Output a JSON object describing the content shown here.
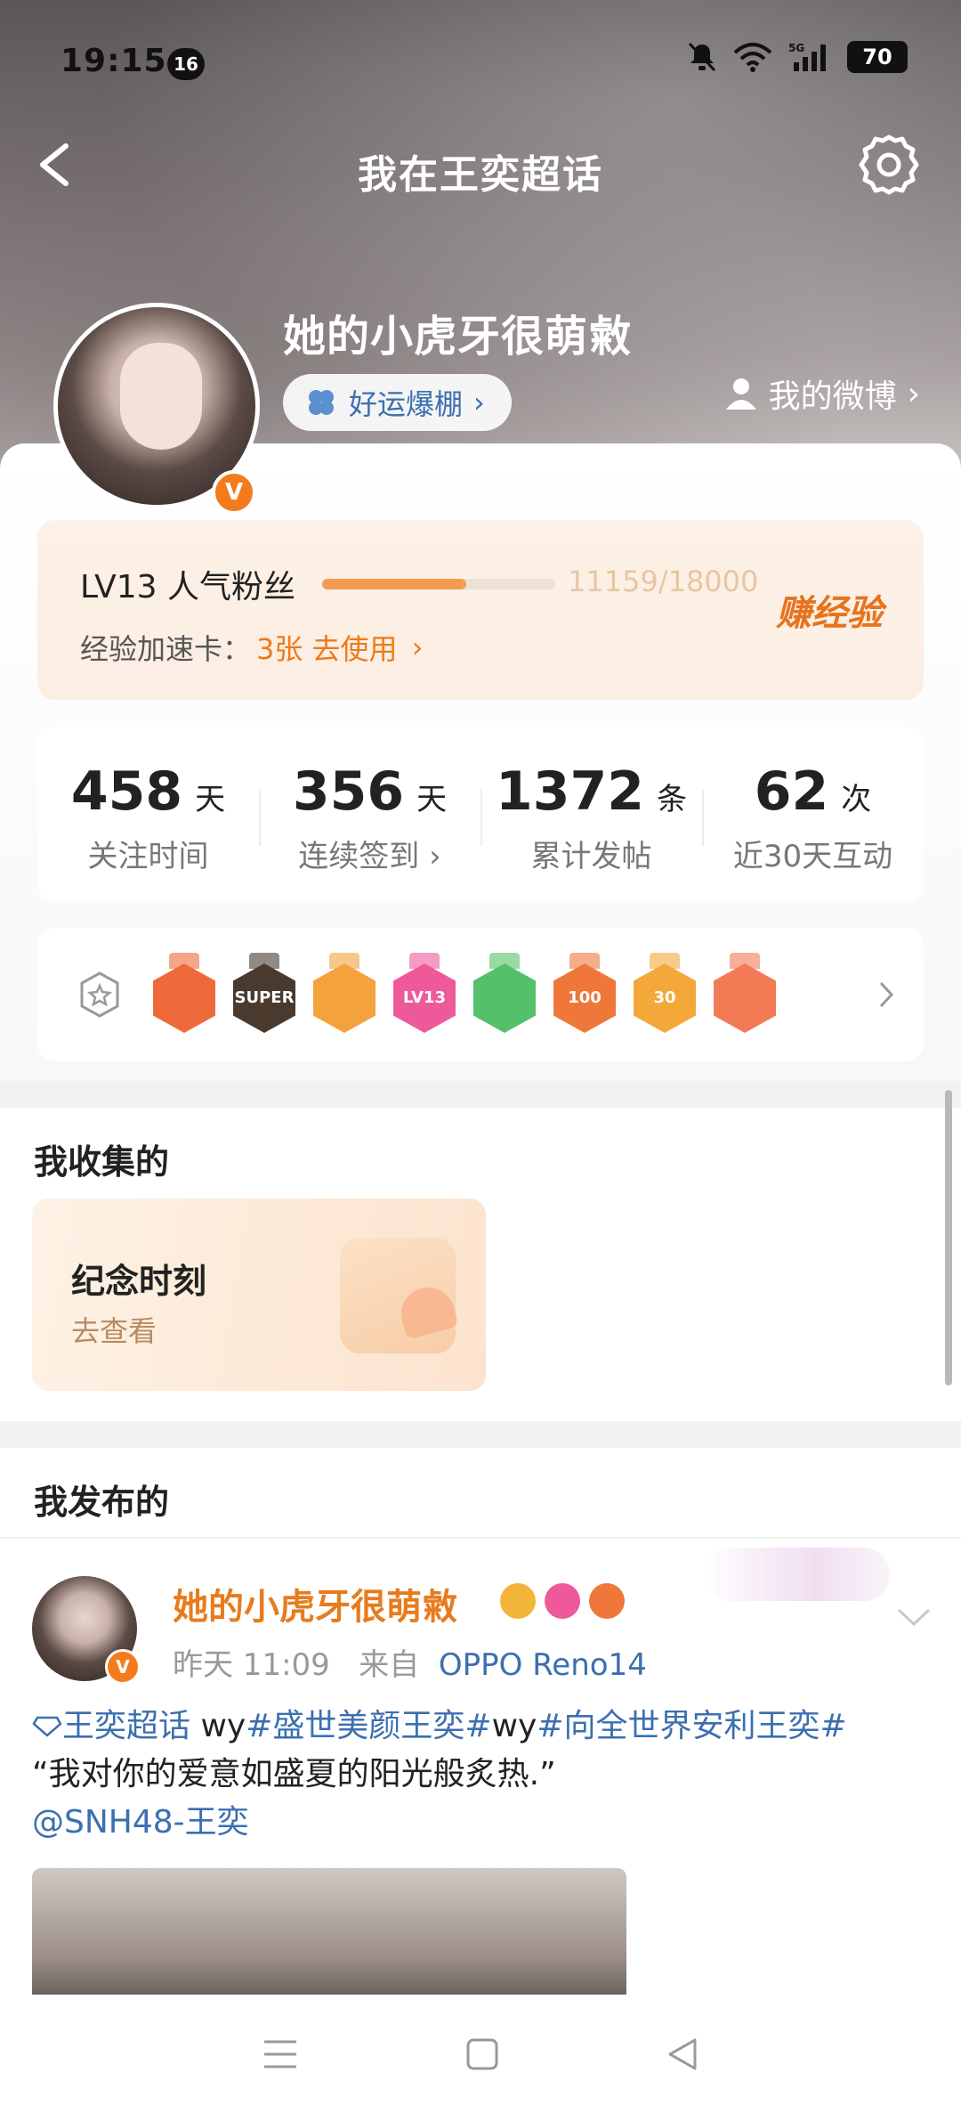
{
  "status_bar": {
    "time": "19:15",
    "notif_count": "16",
    "battery": "70"
  },
  "header": {
    "title": "我在王奕超话"
  },
  "profile": {
    "username": "她的小虎牙很萌敹",
    "luck_tag": "好运爆棚",
    "my_weibo": "我的微博"
  },
  "level": {
    "label": "LV13 人气粉丝",
    "progress_text": "11159/18000",
    "progress_fraction": 0.62,
    "exp_card_label": "经验加速卡：",
    "exp_card_value": "3张 去使用",
    "earn_exp": "赚经验"
  },
  "stats": [
    {
      "value": "458",
      "unit": "天",
      "label": "关注时间"
    },
    {
      "value": "356",
      "unit": "天",
      "label": "连续签到 ›"
    },
    {
      "value": "1372",
      "unit": "条",
      "label": "累计发帖"
    },
    {
      "value": "62",
      "unit": "次",
      "label": "近30天互动"
    }
  ],
  "badges": {
    "items": [
      {
        "name": "fox-medal",
        "text": "",
        "color": "#ef6a3a"
      },
      {
        "name": "super-medal",
        "text": "SUPER",
        "color": "#4a3a2e"
      },
      {
        "name": "crown-medal",
        "text": "",
        "color": "#f4a23c"
      },
      {
        "name": "lv13-medal",
        "text": "LV13",
        "color": "#ee5a99"
      },
      {
        "name": "hand-medal",
        "text": "",
        "color": "#55c06a"
      },
      {
        "name": "100days-medal",
        "text": "100",
        "color": "#f0773a"
      },
      {
        "name": "30days-medal",
        "text": "30",
        "color": "#f5a83a"
      },
      {
        "name": "rock-medal",
        "text": "",
        "color": "#f27a55"
      }
    ]
  },
  "collect": {
    "title": "我收集的",
    "card_title": "纪念时刻",
    "card_sub": "去查看"
  },
  "posted": {
    "title": "我发布的",
    "post": {
      "author": "她的小虎牙很萌敹",
      "time": "昨天 11:09",
      "from_label": "来自",
      "device": "OPPO Reno14",
      "topic": "王奕超话",
      "text_1": " wy",
      "tag_1": "#盛世美颜王奕#",
      "text_2": "wy",
      "tag_2": "#向全世界安利王奕#",
      "quote": "“我对你的爱意如盛夏的阳光般炙热.”",
      "mention": "@SNH48-王奕"
    }
  },
  "colors": {
    "accent_orange": "#ed7a19",
    "link_blue": "#3b6fb0"
  }
}
